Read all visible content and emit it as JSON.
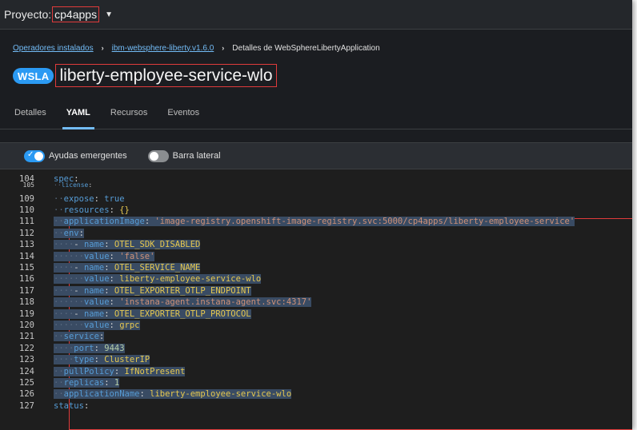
{
  "project": {
    "label": "Proyecto:",
    "value": "cp4apps"
  },
  "breadcrumb": {
    "items": [
      "Operadores instalados",
      "ibm-websphere-liberty.v1.6.0"
    ],
    "current": "Detalles de WebSphereLibertyApplication"
  },
  "resource": {
    "badge": "WSLA",
    "name": "liberty-employee-service-wlo"
  },
  "tabs": [
    "Detalles",
    "YAML",
    "Recursos",
    "Eventos"
  ],
  "active_tab": "YAML",
  "toggles": {
    "popups_label": "Ayudas emergentes",
    "popups_on": true,
    "sidebar_label": "Barra lateral",
    "sidebar_on": false
  },
  "editor": {
    "lines": [
      {
        "n": "104",
        "text": "spec:"
      },
      {
        "n": "105",
        "text": "  license:"
      },
      {
        "n": "109",
        "text": "  expose: true"
      },
      {
        "n": "110",
        "text": "  resources: {}"
      },
      {
        "n": "111",
        "text": "  applicationImage: 'image-registry.openshift-image-registry.svc:5000/cp4apps/liberty-employee-service'"
      },
      {
        "n": "112",
        "text": "  env:"
      },
      {
        "n": "113",
        "text": "    - name: OTEL_SDK_DISABLED"
      },
      {
        "n": "114",
        "text": "      value: 'false'"
      },
      {
        "n": "115",
        "text": "    - name: OTEL_SERVICE_NAME"
      },
      {
        "n": "116",
        "text": "      value: liberty-employee-service-wlo"
      },
      {
        "n": "117",
        "text": "    - name: OTEL_EXPORTER_OTLP_ENDPOINT"
      },
      {
        "n": "118",
        "text": "      value: 'instana-agent.instana-agent.svc:4317'"
      },
      {
        "n": "119",
        "text": "    - name: OTEL_EXPORTER_OTLP_PROTOCOL"
      },
      {
        "n": "120",
        "text": "      value: grpc"
      },
      {
        "n": "121",
        "text": "  service:"
      },
      {
        "n": "122",
        "text": "    port: 9443"
      },
      {
        "n": "123",
        "text": "    type: ClusterIP"
      },
      {
        "n": "124",
        "text": "  pullPolicy: IfNotPresent"
      },
      {
        "n": "125",
        "text": "  replicas: 1"
      },
      {
        "n": "126",
        "text": "  applicationName: liberty-employee-service-wlo"
      },
      {
        "n": "127",
        "text": "status:"
      }
    ]
  },
  "colors": {
    "accent": "#2b9af3",
    "highlight_box": "#e03b3b",
    "link": "#73bcf7"
  }
}
